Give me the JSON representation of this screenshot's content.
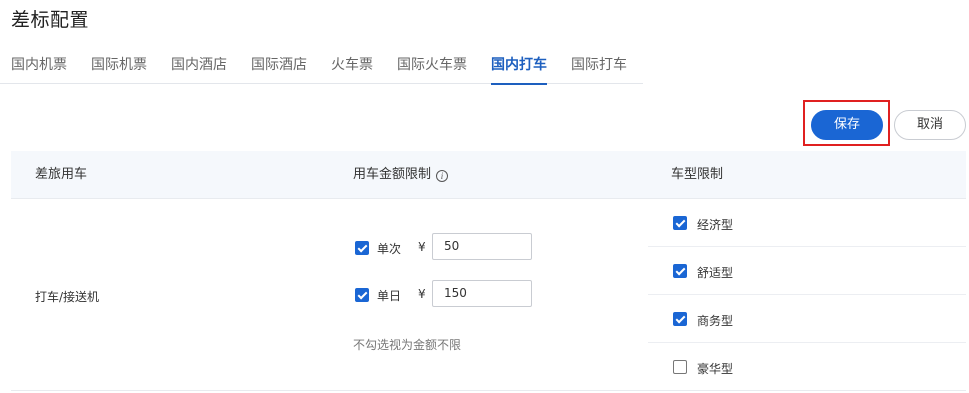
{
  "page": {
    "title": "差标配置"
  },
  "tabs": [
    {
      "label": "国内机票",
      "active": false
    },
    {
      "label": "国际机票",
      "active": false
    },
    {
      "label": "国内酒店",
      "active": false
    },
    {
      "label": "国际酒店",
      "active": false
    },
    {
      "label": "火车票",
      "active": false
    },
    {
      "label": "国际火车票",
      "active": false
    },
    {
      "label": "国内打车",
      "active": true
    },
    {
      "label": "国际打车",
      "active": false
    }
  ],
  "toolbar": {
    "save_label": "保存",
    "cancel_label": "取消"
  },
  "table": {
    "headers": {
      "travel": "差旅用车",
      "amount_limit": "用车金额限制",
      "car_type": "车型限制"
    },
    "row": {
      "label": "打车/接送机",
      "single": {
        "checked": true,
        "label": "单次",
        "currency": "¥",
        "value": "50"
      },
      "daily": {
        "checked": true,
        "label": "单日",
        "currency": "¥",
        "value": "150"
      },
      "hint": "不勾选视为金额不限",
      "car_types": [
        {
          "label": "经济型",
          "checked": true
        },
        {
          "label": "舒适型",
          "checked": true
        },
        {
          "label": "商务型",
          "checked": true
        },
        {
          "label": "豪华型",
          "checked": false
        }
      ]
    }
  },
  "colors": {
    "primary": "#1a66d4",
    "highlight": "#e02020",
    "header_bg": "#f5f8fc"
  },
  "icons": {
    "info": "info-circle-icon",
    "checkbox": "checkbox-icon"
  }
}
